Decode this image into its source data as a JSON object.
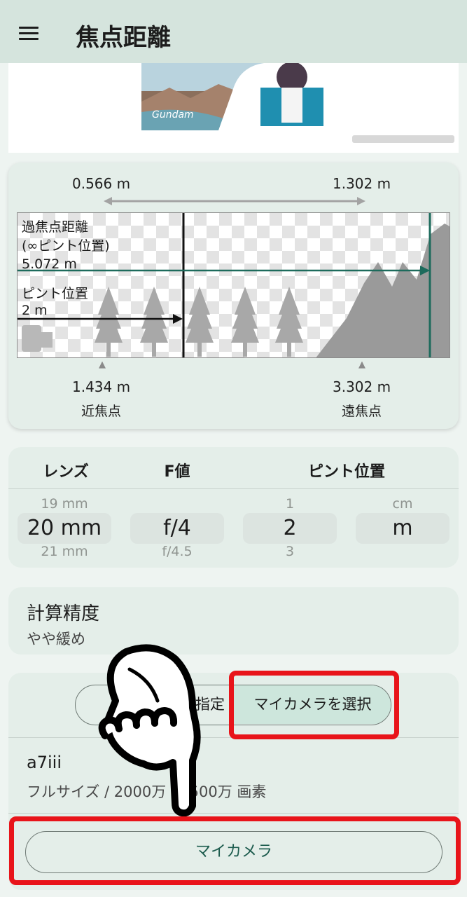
{
  "appbar": {
    "title": "焦点距離",
    "menu_icon": "hamburger-menu-icon"
  },
  "ad": {
    "image": "anime-banner-ad"
  },
  "dof": {
    "front_depth": "0.566 m",
    "rear_depth": "1.302 m",
    "hyperfocal_label_1": "過焦点距離",
    "hyperfocal_label_2": "(∞ピント位置)",
    "hyperfocal_value": "5.072 m",
    "focus_label": "ピント位置",
    "focus_value": "2 m",
    "near_value": "1.434 m",
    "near_label": "近焦点",
    "far_value": "3.302 m",
    "far_label": "遠焦点",
    "accent_color": "#1d6b5c"
  },
  "settings": {
    "headers": {
      "lens": "レンズ",
      "fvalue": "F値",
      "focus": "ピント位置"
    },
    "lens": {
      "prev": "19 mm",
      "selected": "20 mm",
      "next": "21 mm"
    },
    "fvalue": {
      "prev": "",
      "selected": "f/4",
      "next": "f/4.5"
    },
    "focus": {
      "prev": "1",
      "selected": "2",
      "next": "3"
    },
    "unit": {
      "prev": "cm",
      "selected": "m",
      "next": ""
    }
  },
  "accuracy": {
    "title": "計算精度",
    "value": "やや緩め"
  },
  "camera": {
    "segment_left": "指定",
    "segment_right": "マイカメラを選択",
    "name": "a7iii",
    "spec_left": "フルサイズ / 2000万",
    "spec_right": "2500万 画素",
    "button": "マイカメラ"
  },
  "annotations": {
    "highlight_color": "#e8141a",
    "pointer": "pointing-hand-icon"
  }
}
